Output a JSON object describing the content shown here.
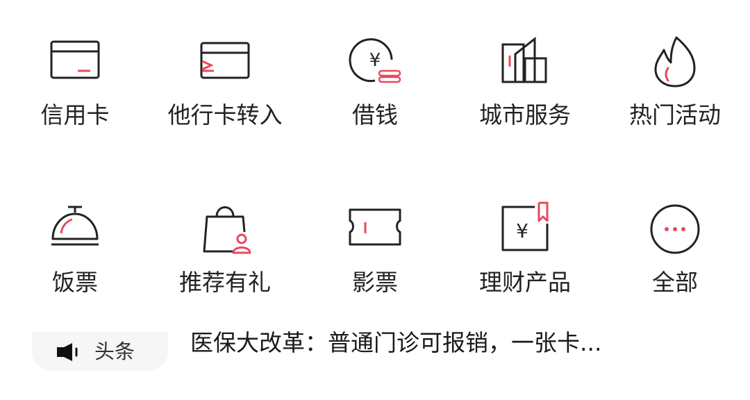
{
  "grid": {
    "items": [
      {
        "label": "信用卡",
        "icon": "credit-card-icon"
      },
      {
        "label": "他行卡转入",
        "icon": "card-transfer-icon"
      },
      {
        "label": "借钱",
        "icon": "yuan-coin-icon"
      },
      {
        "label": "城市服务",
        "icon": "city-buildings-icon"
      },
      {
        "label": "热门活动",
        "icon": "flame-icon"
      },
      {
        "label": "饭票",
        "icon": "food-cloche-icon"
      },
      {
        "label": "推荐有礼",
        "icon": "shopping-bag-user-icon"
      },
      {
        "label": "影票",
        "icon": "movie-ticket-icon"
      },
      {
        "label": "理财产品",
        "icon": "yuan-bookmark-icon"
      },
      {
        "label": "全部",
        "icon": "more-dots-icon"
      }
    ]
  },
  "headline": {
    "tag": "头条",
    "text": "医保大改革：普通门诊可报销，一张卡...",
    "icon": "speaker-icon"
  },
  "colors": {
    "accent": "#e8495b",
    "stroke": "#222222"
  }
}
